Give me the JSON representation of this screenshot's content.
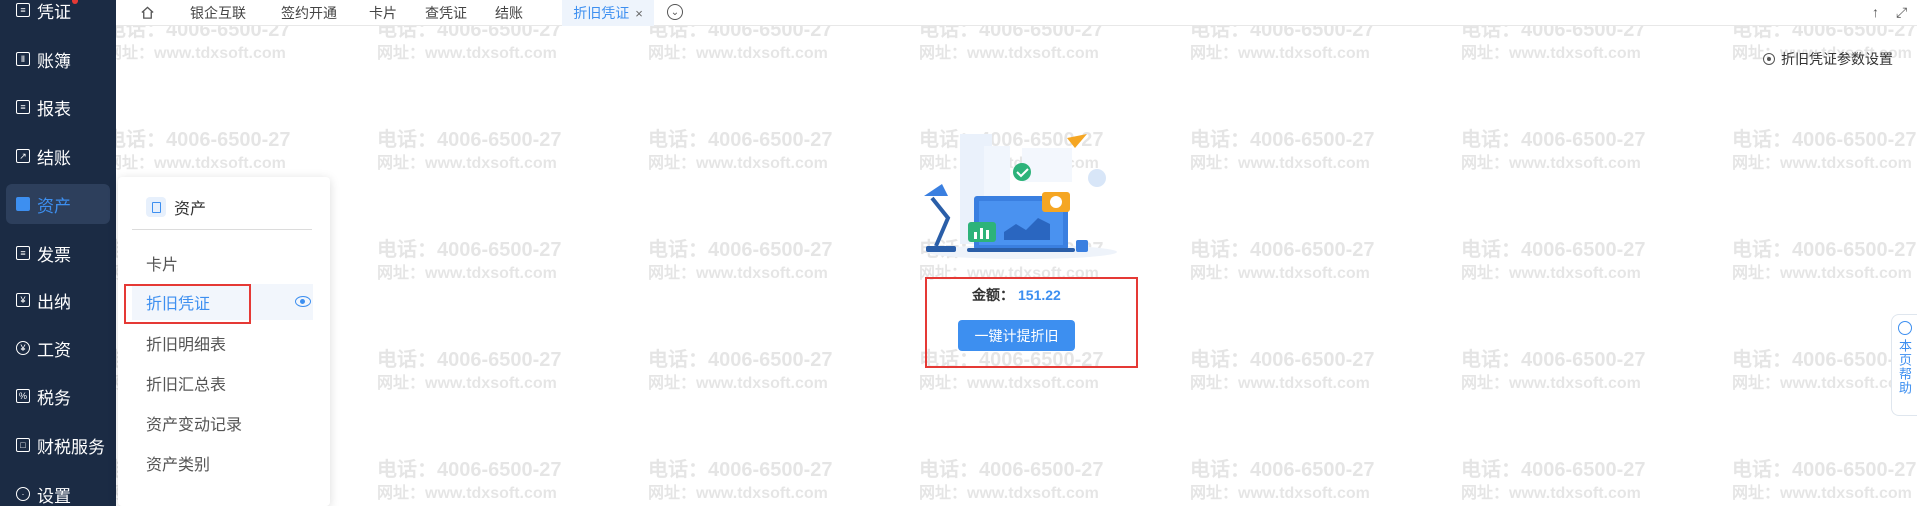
{
  "sidebar": {
    "items": [
      {
        "label": "凭证",
        "icon": "voucher-icon"
      },
      {
        "label": "账簿",
        "icon": "ledger-icon"
      },
      {
        "label": "报表",
        "icon": "report-icon"
      },
      {
        "label": "结账",
        "icon": "closing-icon"
      },
      {
        "label": "资产",
        "icon": "asset-icon",
        "active": true
      },
      {
        "label": "发票",
        "icon": "invoice-icon"
      },
      {
        "label": "出纳",
        "icon": "cashier-icon"
      },
      {
        "label": "工资",
        "icon": "salary-icon"
      },
      {
        "label": "税务",
        "icon": "tax-icon"
      },
      {
        "label": "财税服务",
        "icon": "finance-service-icon"
      },
      {
        "label": "设置",
        "icon": "settings-icon"
      }
    ]
  },
  "tabs": [
    {
      "label": "银企互联"
    },
    {
      "label": "签约开通"
    },
    {
      "label": "卡片"
    },
    {
      "label": "查凭证"
    },
    {
      "label": "结账"
    },
    {
      "label": "折旧凭证",
      "active": true,
      "close": "×"
    }
  ],
  "watermark": {
    "line1": "电话：4006-6500-27",
    "line2": "网址：www.tdxsoft.com"
  },
  "main": {
    "settings_link": "折旧凭证参数设置",
    "amount_label": "金额：",
    "amount_value": "151.22",
    "action_button": "一键计提折旧"
  },
  "submenu": {
    "title": "资产",
    "items": [
      {
        "label": "卡片"
      },
      {
        "label": "折旧凭证",
        "active": true
      },
      {
        "label": "折旧明细表"
      },
      {
        "label": "折旧汇总表"
      },
      {
        "label": "资产变动记录"
      },
      {
        "label": "资产类别"
      }
    ]
  },
  "help_tab": {
    "label": "本页帮助"
  },
  "colors": {
    "sidebar_bg": "#1b2b44",
    "accent": "#3d8ff0",
    "highlight_box": "#e53935"
  }
}
